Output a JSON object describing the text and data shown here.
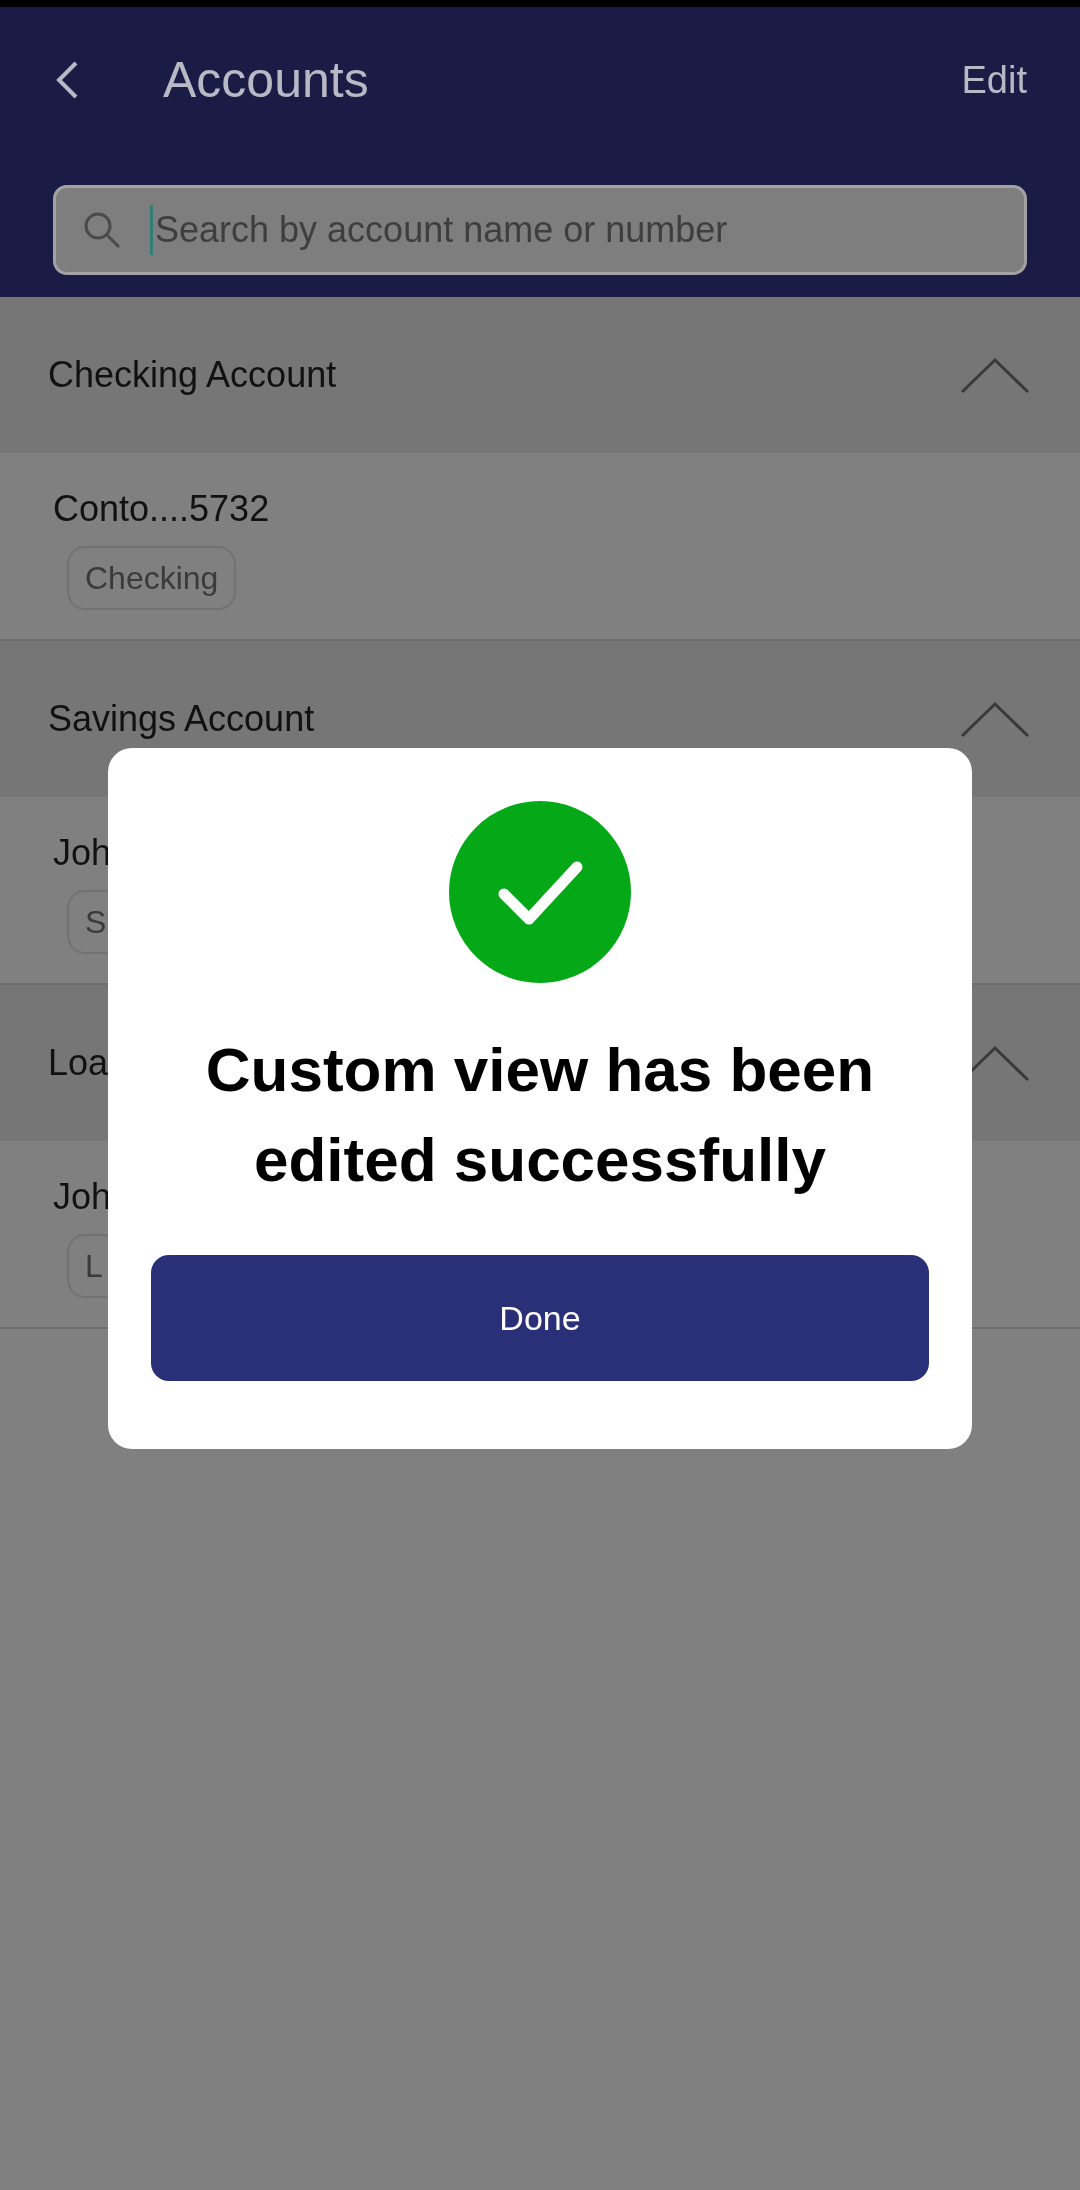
{
  "header": {
    "title": "Accounts",
    "edit": "Edit"
  },
  "search": {
    "placeholder": "Search by account name or number"
  },
  "sections": [
    {
      "title": "Checking Account",
      "expanded": true,
      "accounts": [
        {
          "name": "Conto....5732",
          "type": "Checking"
        }
      ]
    },
    {
      "title": "Savings Account",
      "expanded": true,
      "accounts": [
        {
          "name": "Joh",
          "type": "S"
        }
      ]
    },
    {
      "title": "Loa",
      "expanded": true,
      "accounts": [
        {
          "name": "Joh",
          "type": "L"
        }
      ]
    }
  ],
  "dialog": {
    "message": "Custom view has been edited successfully",
    "button": "Done"
  }
}
